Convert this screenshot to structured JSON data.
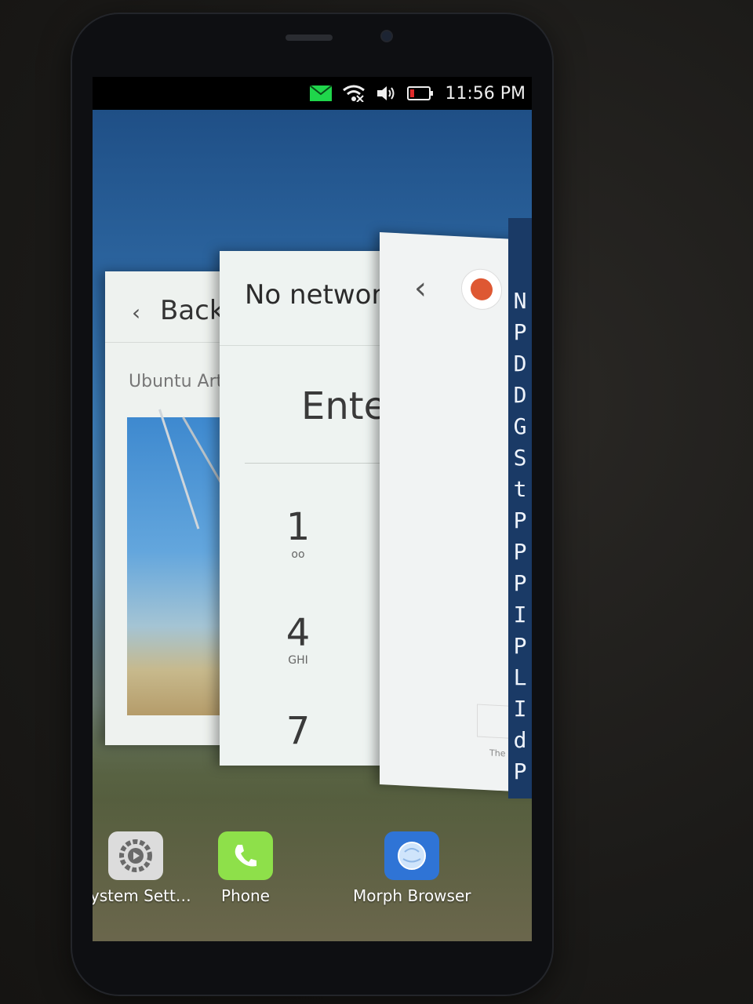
{
  "status_bar": {
    "time": "11:56 PM",
    "icons": [
      "message-icon",
      "wifi-icon",
      "volume-icon",
      "battery-icon"
    ],
    "message_color": "#1fd64b",
    "battery_color": "#e02b2b"
  },
  "app_spread": {
    "system_settings_card": {
      "title": "Backg",
      "subtitle": "Ubuntu Art"
    },
    "phone_card": {
      "title": "No network",
      "input_placeholder": "Ente",
      "keys": [
        {
          "num": "1",
          "sub": "oo"
        },
        {
          "num": "4",
          "sub": "GHI"
        },
        {
          "num": "7",
          "sub": ""
        }
      ]
    },
    "browser_card": {
      "footer": "The"
    }
  },
  "sidebar_letters": [
    "N",
    "P",
    "D",
    "D",
    "G",
    "S",
    "t",
    "P",
    "P",
    "P",
    "I",
    "P",
    "L",
    "I",
    "d",
    "P"
  ],
  "dock": {
    "apps": [
      {
        "label": "System Sett…",
        "icon": "settings-icon"
      },
      {
        "label": "Phone",
        "icon": "phone-icon"
      },
      {
        "label": "Morph Browser",
        "icon": "browser-icon"
      }
    ]
  },
  "colors": {
    "sidebar": "#1a3a66",
    "phone_app": "#8ee04a",
    "browser_app": "#2f74d6"
  }
}
